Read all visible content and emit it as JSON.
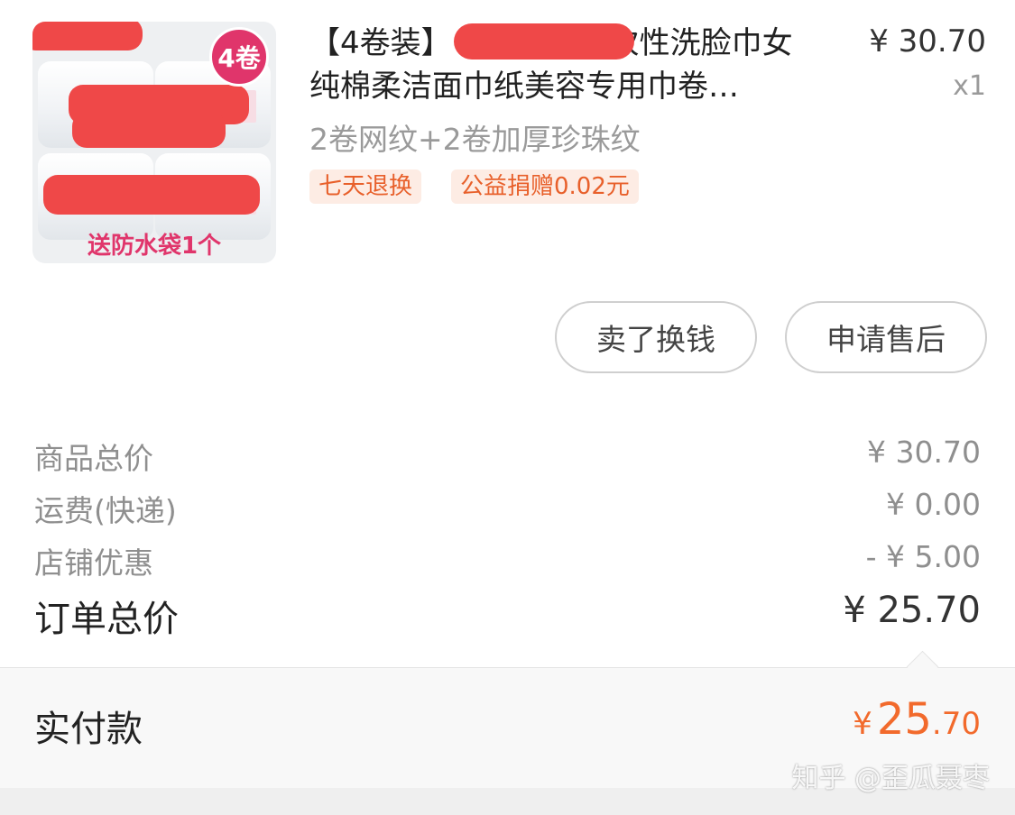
{
  "product": {
    "badge": "4卷",
    "image_caption": "送防水袋1个",
    "title_line1_prefix": "【4卷装】",
    "title_line1_suffix": "次性洗脸巾女",
    "title_line2": "纯棉柔洁面巾纸美容专用巾卷…",
    "price": "¥ 30.70",
    "quantity": "x1",
    "variant": "2卷网纹+2卷加厚珍珠纹",
    "tags": [
      "七天退换",
      "公益捐赠0.02元"
    ]
  },
  "actions": {
    "resell_label": "卖了换钱",
    "after_sale_label": "申请售后"
  },
  "summary": {
    "rows": [
      {
        "label": "商品总价",
        "value": "¥ 30.70"
      },
      {
        "label": "运费(快递)",
        "value": "¥ 0.00"
      },
      {
        "label": "店铺优惠",
        "value": "- ¥ 5.00"
      }
    ],
    "total_label": "订单总价",
    "total_value": "¥ 25.70"
  },
  "payment": {
    "label": "实付款",
    "currency": "¥",
    "integer": "25",
    "decimal": ".70"
  },
  "watermark": "知乎 @歪瓜聂枣",
  "colors": {
    "accent": "#f26a2c",
    "tag_bg": "#fdece4",
    "badge": "#e0356b",
    "redaction": "#ef4848"
  }
}
